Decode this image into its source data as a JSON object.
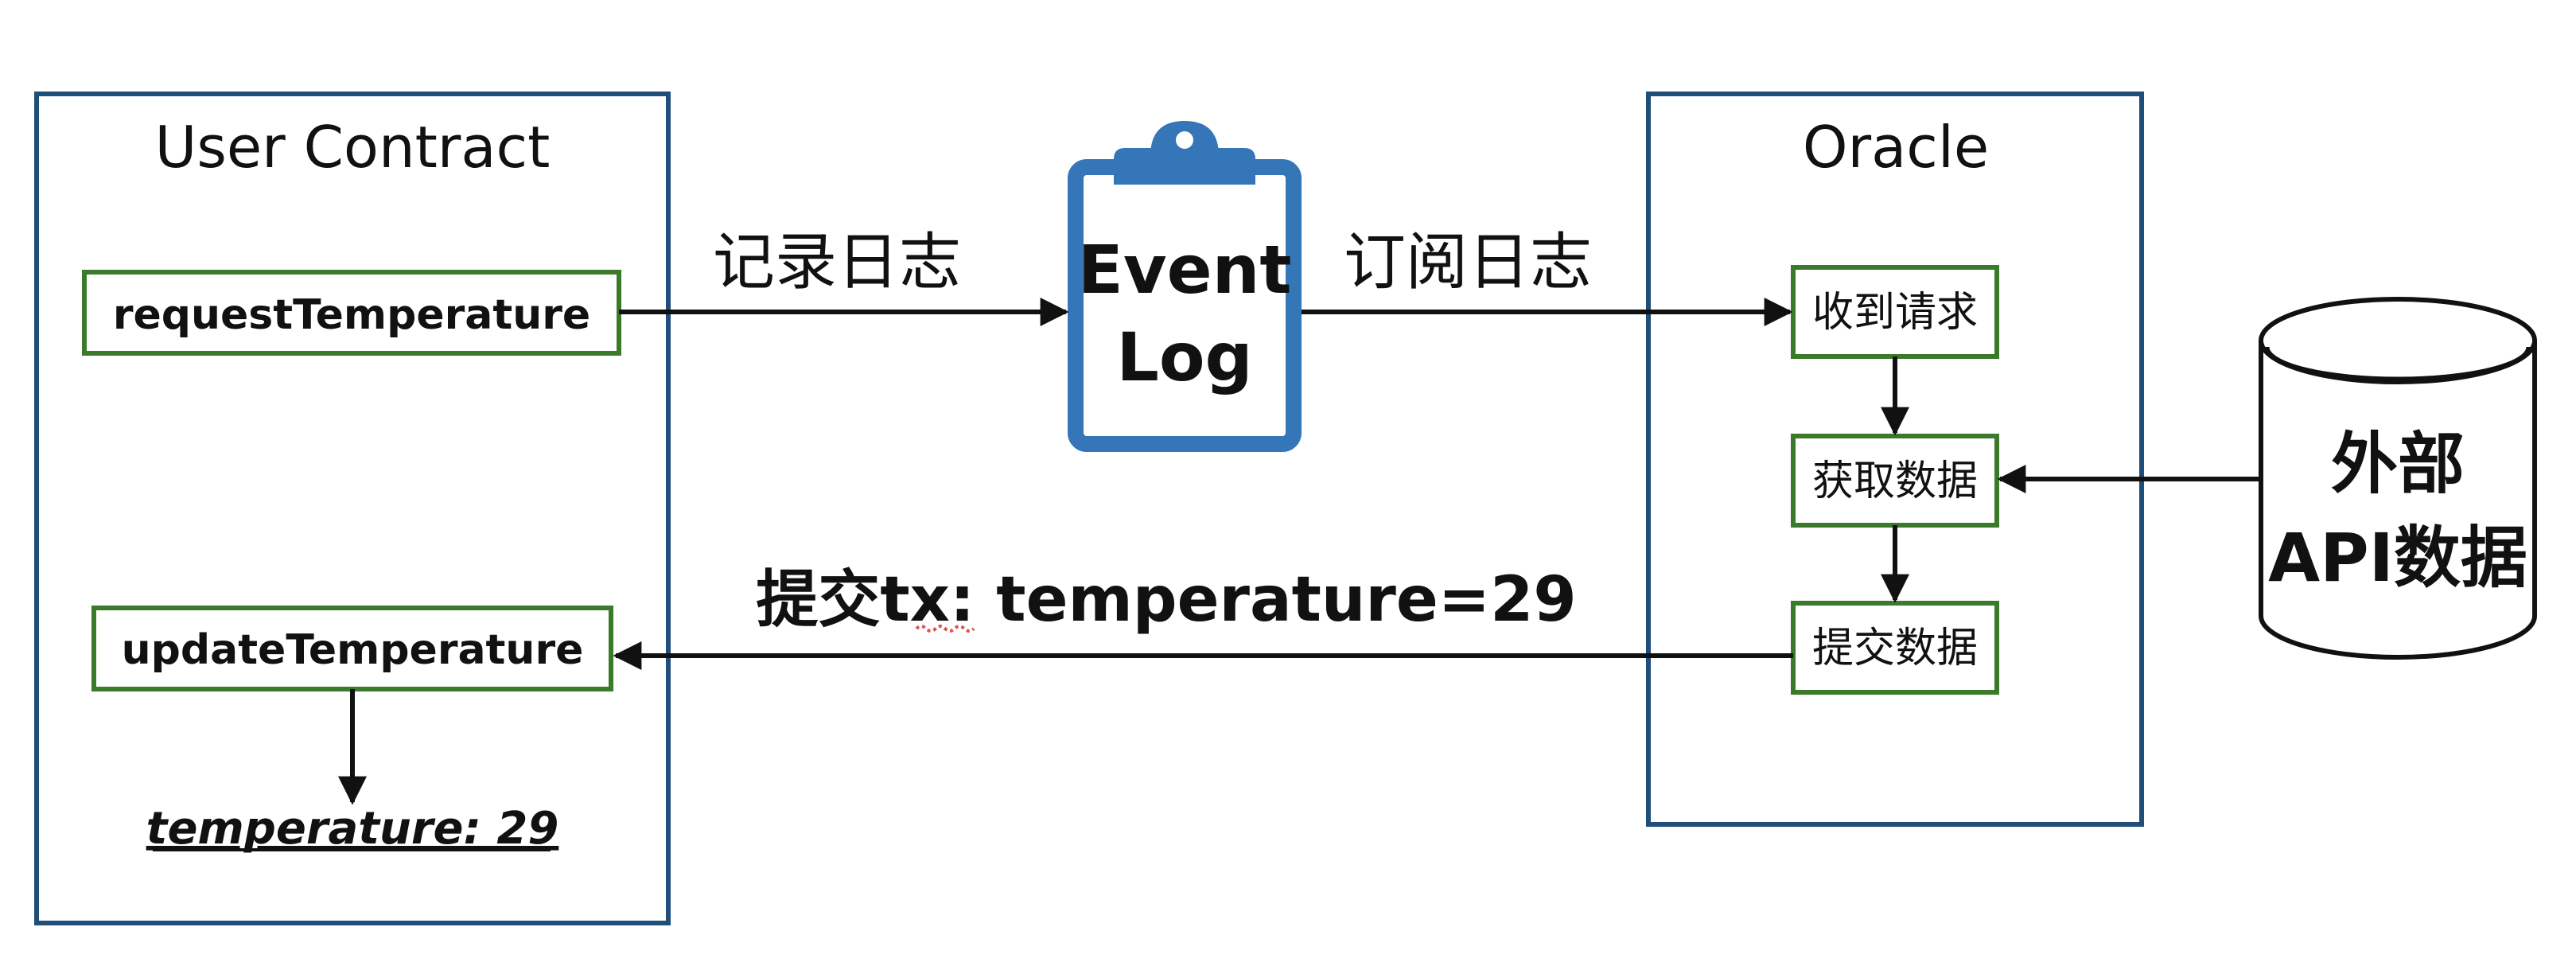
{
  "colors": {
    "container_border": "#1f4e79",
    "node_border": "#3a7a2a",
    "clipboard": "#3476b8",
    "line": "#111111",
    "spellcheck_underline": "#d9534f"
  },
  "user_contract": {
    "title": "User Contract",
    "request_fn": "requestTemperature",
    "update_fn": "updateTemperature",
    "result": "temperature: 29"
  },
  "event_log": {
    "line1": "Event",
    "line2": "Log",
    "icon": "clipboard-icon"
  },
  "oracle": {
    "title": "Oracle",
    "step_receive": "收到请求",
    "step_fetch": "获取数据",
    "step_submit": "提交数据"
  },
  "external_api": {
    "line1": "外部",
    "line2": "API数据",
    "icon": "database-cylinder-icon"
  },
  "edges": {
    "record_log": "记录日志",
    "subscribe_log": "订阅日志",
    "submit_tx_prefix": "提交",
    "submit_tx_word": "tx",
    "submit_tx_rest": ": temperature=29"
  }
}
